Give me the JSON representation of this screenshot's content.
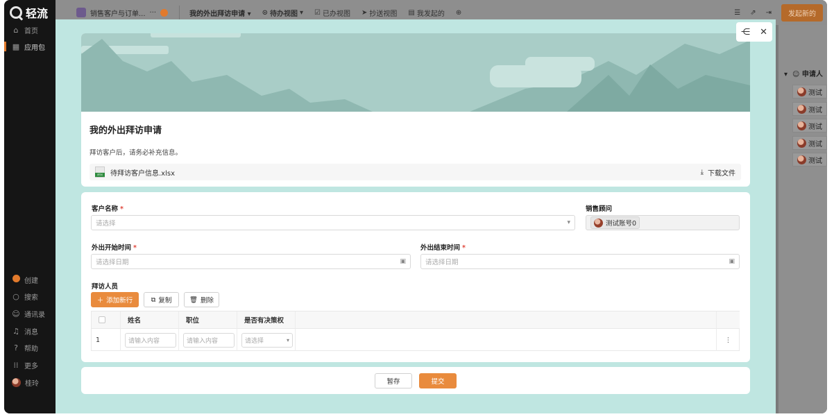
{
  "app": {
    "logo_text": "轻流"
  },
  "sidebar": {
    "items": [
      {
        "label": "首页",
        "icon": "home-icon"
      },
      {
        "label": "应用包",
        "icon": "grid-icon"
      },
      {
        "label": "创建",
        "icon": "plus-circle-icon"
      },
      {
        "label": "搜索",
        "icon": "search-icon"
      },
      {
        "label": "通讯录",
        "icon": "contacts-icon"
      },
      {
        "label": "消息",
        "icon": "bell-icon"
      },
      {
        "label": "帮助",
        "icon": "help-icon"
      },
      {
        "label": "更多",
        "icon": "more-grid-icon"
      },
      {
        "label": "桂玲",
        "icon": "avatar"
      }
    ]
  },
  "topbar": {
    "app_name": "销售客户与订单...",
    "more": "···",
    "current_form": "我的外出拜访申请",
    "views": [
      {
        "label": "待办视图"
      },
      {
        "label": "已办视图"
      },
      {
        "label": "抄送视图"
      },
      {
        "label": "我发起的"
      }
    ],
    "start_button": "发起新的"
  },
  "background": {
    "column_header": "申请人",
    "rows": [
      "测试",
      "测试",
      "测试",
      "测试",
      "测试"
    ]
  },
  "form": {
    "title": "我的外出拜访申请",
    "description": "拜访客户后，请务必补充信息。",
    "attachment": {
      "file_name": "待拜访客户信息.xlsx",
      "download_label": "下载文件"
    },
    "fields": {
      "customer": {
        "label": "客户名称",
        "required_mark": "*",
        "placeholder": "请选择"
      },
      "advisor": {
        "label": "销售顾问",
        "value": "测试账号0"
      },
      "start_time": {
        "label": "外出开始时间",
        "required_mark": "*",
        "placeholder": "请选择日期"
      },
      "end_time": {
        "label": "外出结束时间",
        "required_mark": "*",
        "placeholder": "请选择日期"
      },
      "visitors": {
        "label": "拜访人员"
      }
    },
    "table_actions": {
      "add_row": "添加新行",
      "copy": "复制",
      "delete": "删除"
    },
    "table": {
      "columns": [
        "姓名",
        "职位",
        "是否有决策权"
      ],
      "rows": [
        {
          "index": "1",
          "name_placeholder": "请输入内容",
          "position_placeholder": "请输入内容",
          "decision_placeholder": "请选择"
        }
      ]
    },
    "footer": {
      "save_draft": "暂存",
      "submit": "提交"
    }
  },
  "colors": {
    "accent": "#e98b3d",
    "modal_bg": "#bfe6e1",
    "hero_bg": "#9ec3bd"
  }
}
